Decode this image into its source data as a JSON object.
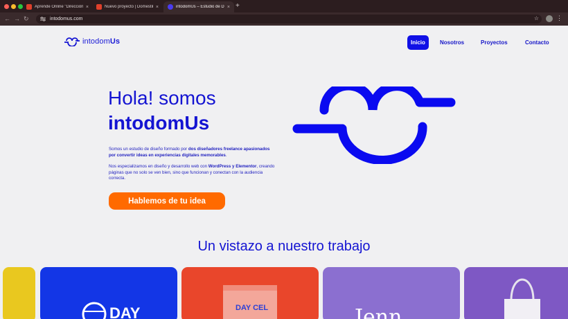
{
  "browser": {
    "tabs": [
      {
        "label": "Aprende Online \"Dirección de",
        "favicon_color": "#e0402b"
      },
      {
        "label": "Nuevo proyecto | Domestika",
        "favicon_color": "#e0402b"
      },
      {
        "label": "intodomUs – Estudio de Diseño",
        "favicon_color": "#4a3cf0"
      }
    ],
    "new_tab": "+",
    "close_glyph": "×",
    "url": "intodomus.com"
  },
  "site": {
    "logo": {
      "prefix": "intodom",
      "suffix": "Us"
    },
    "nav": [
      "Inicio",
      "Nosotros",
      "Proyectos",
      "Contacto"
    ],
    "hero": {
      "title_line1": "Hola! somos",
      "title_line2": "intodomUs",
      "p1_a": "Somos un estudio de diseño formado por ",
      "p1_b": "dos diseñadores freelance apasionados por convertir ideas en experiencias digitales memorables",
      "p1_c": ".",
      "p2_a": "Nos especializamos en diseño y desarrollo web con ",
      "p2_b": "WordPress y Elementor",
      "p2_c": ", creando páginas que no solo se ven bien, sino que funcionan y conectan con la audiencia correcta.",
      "cta": "Hablemos de tu idea"
    },
    "work_title": "Un vistazo a nuestro trabajo",
    "cards": [
      {
        "color": "#e9c81f"
      },
      {
        "color": "#1336e6",
        "text": "DAY"
      },
      {
        "color": "#e9462b",
        "text": "DAY CEL"
      },
      {
        "color": "#8b6fd0",
        "text": "Jenn"
      },
      {
        "color": "#7e58c4"
      }
    ]
  },
  "colors": {
    "brand_blue": "#1414d2",
    "accent_orange": "#ff6a00"
  }
}
